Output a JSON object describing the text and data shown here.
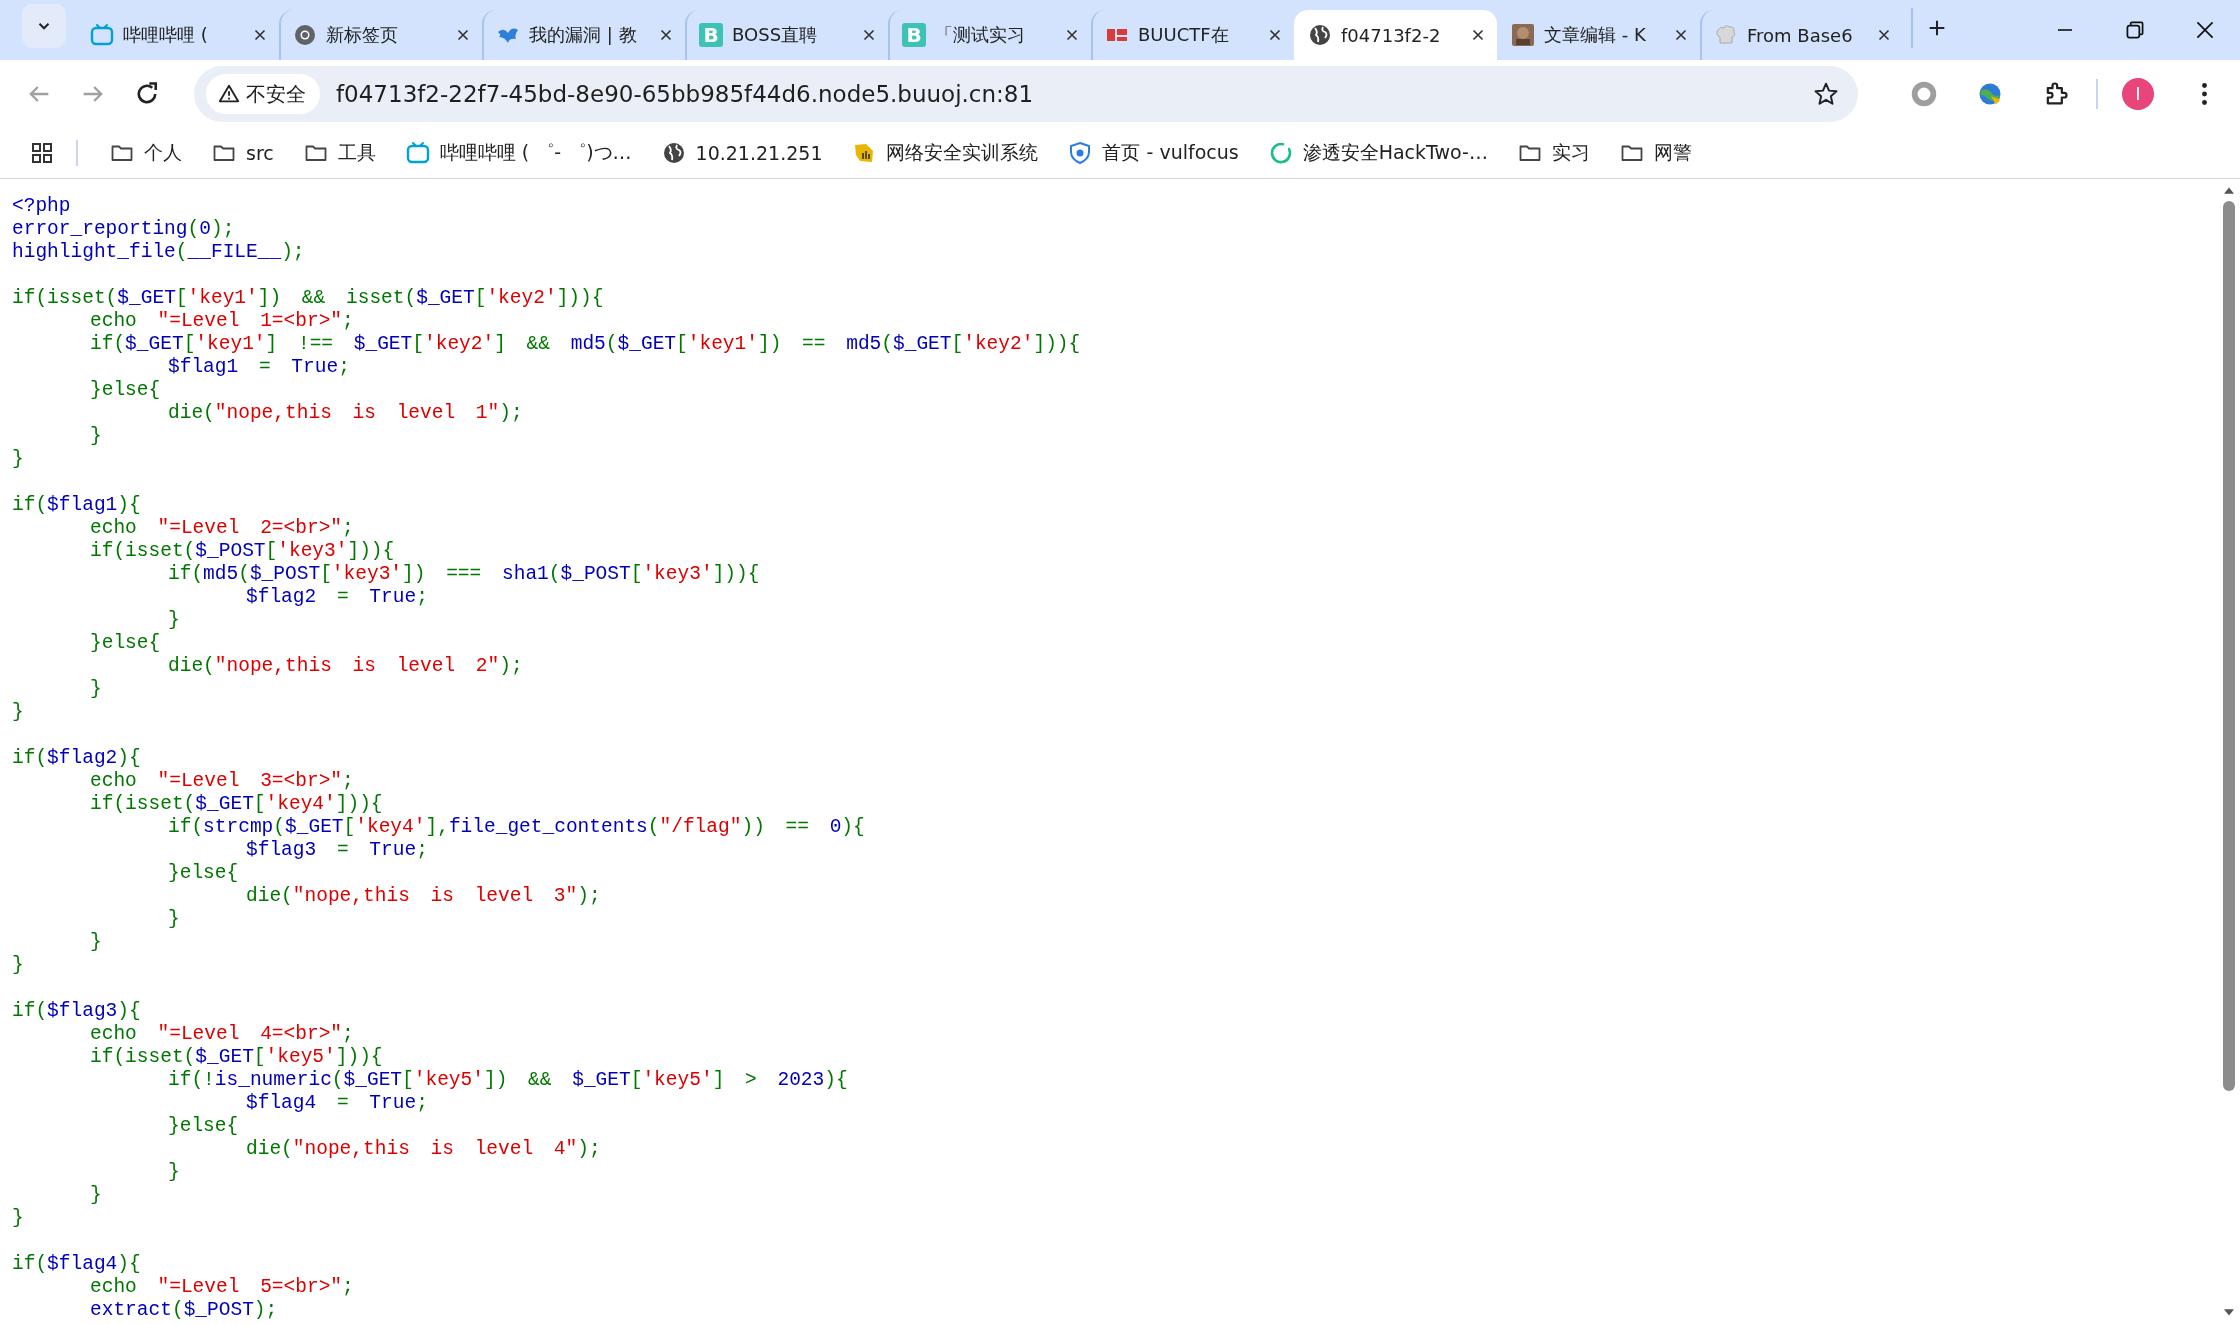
{
  "tabs": [
    {
      "kind": "tv",
      "title": "哔哩哔哩 (",
      "selected": false
    },
    {
      "kind": "ring",
      "title": "新标签页",
      "selected": false
    },
    {
      "kind": "bird",
      "title": "我的漏洞 | 教",
      "selected": false
    },
    {
      "kind": "letter",
      "letter": "B",
      "title": "BOSS直聘",
      "selected": false
    },
    {
      "kind": "letter",
      "letter": "B",
      "title": "「测试实习",
      "selected": false
    },
    {
      "kind": "red",
      "title": "BUUCTF在",
      "selected": false
    },
    {
      "kind": "globe",
      "title": "f04713f2-2",
      "selected": true
    },
    {
      "kind": "thumb",
      "title": "文章编辑 - K",
      "selected": false
    },
    {
      "kind": "hat",
      "title": "From Base6",
      "selected": false
    }
  ],
  "navigation": {
    "back": {
      "disabled": true
    },
    "forward": {
      "disabled": true
    }
  },
  "address_bar": {
    "security_label": "不安全",
    "url": "f04713f2-22f7-45bd-8e90-65bb985f44d6.node5.buuoj.cn:81"
  },
  "profile": {
    "initial": "I"
  },
  "bookmarks": [
    {
      "kind": "folder",
      "label": "个人"
    },
    {
      "kind": "folder",
      "label": "src"
    },
    {
      "kind": "folder",
      "label": "工具"
    },
    {
      "kind": "tv",
      "label": "哔哩哔哩 ( ゜- ゜)つ…"
    },
    {
      "kind": "globe",
      "label": "10.21.21.251"
    },
    {
      "kind": "badge",
      "label": "网络安全实训系统"
    },
    {
      "kind": "shield",
      "label": "首页 - vulfocus"
    },
    {
      "kind": "ring",
      "label": "渗透安全HackTwo-…"
    },
    {
      "kind": "folder",
      "label": "实习"
    },
    {
      "kind": "folder",
      "label": "网警"
    }
  ],
  "code": {
    "blocks": [
      [
        [
          {
            "kind": "d",
            "text": "<?php"
          }
        ],
        [
          {
            "kind": "d",
            "text": "error_reporting"
          },
          {
            "kind": "k",
            "text": "("
          },
          {
            "kind": "d",
            "text": "0"
          },
          {
            "kind": "k",
            "text": ");"
          }
        ],
        [
          {
            "kind": "d",
            "text": "highlight_file"
          },
          {
            "kind": "k",
            "text": "("
          },
          {
            "kind": "d",
            "text": "__FILE__"
          },
          {
            "kind": "k",
            "text": ");"
          }
        ]
      ],
      [
        [
          {
            "kind": "k",
            "text": "if(isset("
          },
          {
            "kind": "d",
            "text": "$_GET"
          },
          {
            "kind": "k",
            "text": "["
          },
          {
            "kind": "s",
            "text": "'key1'"
          },
          {
            "kind": "k",
            "text": "]) && isset("
          },
          {
            "kind": "d",
            "text": "$_GET"
          },
          {
            "kind": "k",
            "text": "["
          },
          {
            "kind": "s",
            "text": "'key2'"
          },
          {
            "kind": "k",
            "text": "])){"
          }
        ],
        [
          {
            "kind": "k",
            "text": "\techo "
          },
          {
            "kind": "s",
            "text": "\"=Level 1=<br>\""
          },
          {
            "kind": "k",
            "text": ";"
          }
        ],
        [
          {
            "kind": "k",
            "text": "\tif("
          },
          {
            "kind": "d",
            "text": "$_GET"
          },
          {
            "kind": "k",
            "text": "["
          },
          {
            "kind": "s",
            "text": "'key1'"
          },
          {
            "kind": "k",
            "text": "] !== "
          },
          {
            "kind": "d",
            "text": "$_GET"
          },
          {
            "kind": "k",
            "text": "["
          },
          {
            "kind": "s",
            "text": "'key2'"
          },
          {
            "kind": "k",
            "text": "] && "
          },
          {
            "kind": "d",
            "text": "md5"
          },
          {
            "kind": "k",
            "text": "("
          },
          {
            "kind": "d",
            "text": "$_GET"
          },
          {
            "kind": "k",
            "text": "["
          },
          {
            "kind": "s",
            "text": "'key1'"
          },
          {
            "kind": "k",
            "text": "]) == "
          },
          {
            "kind": "d",
            "text": "md5"
          },
          {
            "kind": "k",
            "text": "("
          },
          {
            "kind": "d",
            "text": "$_GET"
          },
          {
            "kind": "k",
            "text": "["
          },
          {
            "kind": "s",
            "text": "'key2'"
          },
          {
            "kind": "k",
            "text": "])){"
          }
        ],
        [
          {
            "kind": "d",
            "text": "\t\t$flag1"
          },
          {
            "kind": "k",
            "text": " = "
          },
          {
            "kind": "d",
            "text": "True"
          },
          {
            "kind": "k",
            "text": ";"
          }
        ],
        [
          {
            "kind": "k",
            "text": "\t}else{"
          }
        ],
        [
          {
            "kind": "k",
            "text": "\t\tdie("
          },
          {
            "kind": "s",
            "text": "\"nope,this is level 1\""
          },
          {
            "kind": "k",
            "text": ");"
          }
        ],
        [
          {
            "kind": "k",
            "text": "\t}"
          }
        ],
        [
          {
            "kind": "k",
            "text": "}"
          }
        ]
      ],
      [
        [
          {
            "kind": "k",
            "text": "if("
          },
          {
            "kind": "d",
            "text": "$flag1"
          },
          {
            "kind": "k",
            "text": "){"
          }
        ],
        [
          {
            "kind": "k",
            "text": "\techo "
          },
          {
            "kind": "s",
            "text": "\"=Level 2=<br>\""
          },
          {
            "kind": "k",
            "text": ";"
          }
        ],
        [
          {
            "kind": "k",
            "text": "\tif(isset("
          },
          {
            "kind": "d",
            "text": "$_POST"
          },
          {
            "kind": "k",
            "text": "["
          },
          {
            "kind": "s",
            "text": "'key3'"
          },
          {
            "kind": "k",
            "text": "])){"
          }
        ],
        [
          {
            "kind": "k",
            "text": "\t\tif("
          },
          {
            "kind": "d",
            "text": "md5"
          },
          {
            "kind": "k",
            "text": "("
          },
          {
            "kind": "d",
            "text": "$_POST"
          },
          {
            "kind": "k",
            "text": "["
          },
          {
            "kind": "s",
            "text": "'key3'"
          },
          {
            "kind": "k",
            "text": "]) === "
          },
          {
            "kind": "d",
            "text": "sha1"
          },
          {
            "kind": "k",
            "text": "("
          },
          {
            "kind": "d",
            "text": "$_POST"
          },
          {
            "kind": "k",
            "text": "["
          },
          {
            "kind": "s",
            "text": "'key3'"
          },
          {
            "kind": "k",
            "text": "])){"
          }
        ],
        [
          {
            "kind": "d",
            "text": "\t\t\t$flag2"
          },
          {
            "kind": "k",
            "text": " = "
          },
          {
            "kind": "d",
            "text": "True"
          },
          {
            "kind": "k",
            "text": ";"
          }
        ],
        [
          {
            "kind": "k",
            "text": "\t\t}"
          }
        ],
        [
          {
            "kind": "k",
            "text": "\t}else{"
          }
        ],
        [
          {
            "kind": "k",
            "text": "\t\tdie("
          },
          {
            "kind": "s",
            "text": "\"nope,this is level 2\""
          },
          {
            "kind": "k",
            "text": ");"
          }
        ],
        [
          {
            "kind": "k",
            "text": "\t}"
          }
        ],
        [
          {
            "kind": "k",
            "text": "}"
          }
        ]
      ],
      [
        [
          {
            "kind": "k",
            "text": "if("
          },
          {
            "kind": "d",
            "text": "$flag2"
          },
          {
            "kind": "k",
            "text": "){"
          }
        ],
        [
          {
            "kind": "k",
            "text": "\techo "
          },
          {
            "kind": "s",
            "text": "\"=Level 3=<br>\""
          },
          {
            "kind": "k",
            "text": ";"
          }
        ],
        [
          {
            "kind": "k",
            "text": "\tif(isset("
          },
          {
            "kind": "d",
            "text": "$_GET"
          },
          {
            "kind": "k",
            "text": "["
          },
          {
            "kind": "s",
            "text": "'key4'"
          },
          {
            "kind": "k",
            "text": "])){"
          }
        ],
        [
          {
            "kind": "k",
            "text": "\t\tif("
          },
          {
            "kind": "d",
            "text": "strcmp"
          },
          {
            "kind": "k",
            "text": "("
          },
          {
            "kind": "d",
            "text": "$_GET"
          },
          {
            "kind": "k",
            "text": "["
          },
          {
            "kind": "s",
            "text": "'key4'"
          },
          {
            "kind": "k",
            "text": "],"
          },
          {
            "kind": "d",
            "text": "file_get_contents"
          },
          {
            "kind": "k",
            "text": "("
          },
          {
            "kind": "s",
            "text": "\"/flag\""
          },
          {
            "kind": "k",
            "text": ")) == "
          },
          {
            "kind": "d",
            "text": "0"
          },
          {
            "kind": "k",
            "text": "){"
          }
        ],
        [
          {
            "kind": "d",
            "text": "\t\t\t$flag3"
          },
          {
            "kind": "k",
            "text": " = "
          },
          {
            "kind": "d",
            "text": "True"
          },
          {
            "kind": "k",
            "text": ";"
          }
        ],
        [
          {
            "kind": "k",
            "text": "\t\t}else{"
          }
        ],
        [
          {
            "kind": "k",
            "text": "\t\t\tdie("
          },
          {
            "kind": "s",
            "text": "\"nope,this is level 3\""
          },
          {
            "kind": "k",
            "text": ");"
          }
        ],
        [
          {
            "kind": "k",
            "text": "\t\t}"
          }
        ],
        [
          {
            "kind": "k",
            "text": "\t}"
          }
        ],
        [
          {
            "kind": "k",
            "text": "}"
          }
        ]
      ],
      [
        [
          {
            "kind": "k",
            "text": "if("
          },
          {
            "kind": "d",
            "text": "$flag3"
          },
          {
            "kind": "k",
            "text": "){"
          }
        ],
        [
          {
            "kind": "k",
            "text": "\techo "
          },
          {
            "kind": "s",
            "text": "\"=Level 4=<br>\""
          },
          {
            "kind": "k",
            "text": ";"
          }
        ],
        [
          {
            "kind": "k",
            "text": "\tif(isset("
          },
          {
            "kind": "d",
            "text": "$_GET"
          },
          {
            "kind": "k",
            "text": "["
          },
          {
            "kind": "s",
            "text": "'key5'"
          },
          {
            "kind": "k",
            "text": "])){"
          }
        ],
        [
          {
            "kind": "k",
            "text": "\t\tif(!"
          },
          {
            "kind": "d",
            "text": "is_numeric"
          },
          {
            "kind": "k",
            "text": "("
          },
          {
            "kind": "d",
            "text": "$_GET"
          },
          {
            "kind": "k",
            "text": "["
          },
          {
            "kind": "s",
            "text": "'key5'"
          },
          {
            "kind": "k",
            "text": "]) && "
          },
          {
            "kind": "d",
            "text": "$_GET"
          },
          {
            "kind": "k",
            "text": "["
          },
          {
            "kind": "s",
            "text": "'key5'"
          },
          {
            "kind": "k",
            "text": "] > "
          },
          {
            "kind": "d",
            "text": "2023"
          },
          {
            "kind": "k",
            "text": "){"
          }
        ],
        [
          {
            "kind": "d",
            "text": "\t\t\t$flag4"
          },
          {
            "kind": "k",
            "text": " = "
          },
          {
            "kind": "d",
            "text": "True"
          },
          {
            "kind": "k",
            "text": ";"
          }
        ],
        [
          {
            "kind": "k",
            "text": "\t\t}else{"
          }
        ],
        [
          {
            "kind": "k",
            "text": "\t\t\tdie("
          },
          {
            "kind": "s",
            "text": "\"nope,this is level 4\""
          },
          {
            "kind": "k",
            "text": ");"
          }
        ],
        [
          {
            "kind": "k",
            "text": "\t\t}"
          }
        ],
        [
          {
            "kind": "k",
            "text": "\t}"
          }
        ],
        [
          {
            "kind": "k",
            "text": "}"
          }
        ]
      ],
      [
        [
          {
            "kind": "k",
            "text": "if("
          },
          {
            "kind": "d",
            "text": "$flag4"
          },
          {
            "kind": "k",
            "text": "){"
          }
        ],
        [
          {
            "kind": "k",
            "text": "\techo "
          },
          {
            "kind": "s",
            "text": "\"=Level 5=<br>\""
          },
          {
            "kind": "k",
            "text": ";"
          }
        ],
        [
          {
            "kind": "d",
            "text": "\textract"
          },
          {
            "kind": "k",
            "text": "("
          },
          {
            "kind": "d",
            "text": "$_POST"
          },
          {
            "kind": "k",
            "text": ");"
          }
        ]
      ]
    ]
  }
}
